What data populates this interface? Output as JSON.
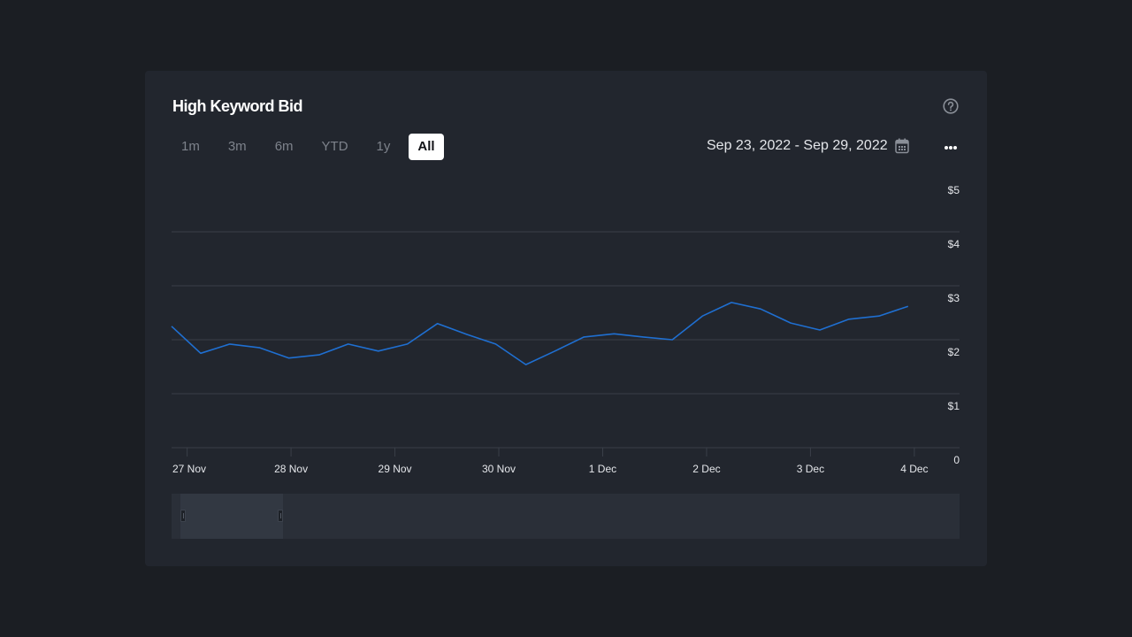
{
  "card": {
    "title": "High Keyword Bid",
    "help_icon": "question-circle-icon",
    "more_icon": "more-horizontal-icon",
    "calendar_icon": "calendar-icon"
  },
  "ranges": [
    {
      "label": "1m",
      "active": false
    },
    {
      "label": "3m",
      "active": false
    },
    {
      "label": "6m",
      "active": false
    },
    {
      "label": "YTD",
      "active": false
    },
    {
      "label": "1y",
      "active": false
    },
    {
      "label": "All",
      "active": true
    }
  ],
  "date_range": "Sep 23, 2022 - Sep 29, 2022",
  "colors": {
    "line": "#1f6fd1",
    "grid": "#3a3f48",
    "axis_text": "#e4e6ea"
  },
  "navigator": {
    "window_start_fraction": 0.0,
    "window_end_fraction": 0.13
  },
  "chart_data": {
    "type": "line",
    "title": "High Keyword Bid",
    "xlabel": "",
    "ylabel": "",
    "ylim": [
      0,
      5
    ],
    "yticks": [
      0,
      1,
      2,
      3,
      4,
      5
    ],
    "ytick_labels": [
      "0",
      "$1",
      "$2",
      "$3",
      "$4",
      "$5"
    ],
    "xlim": [
      -0.15,
      7.35
    ],
    "xticks": [
      0,
      1,
      2,
      3,
      4,
      5,
      6,
      7
    ],
    "xtick_labels": [
      "27 Nov",
      "28 Nov",
      "29 Nov",
      "30 Nov",
      "1 Dec",
      "2 Dec",
      "3 Dec",
      "4 Dec"
    ],
    "grid": true,
    "legend": "none",
    "series": [
      {
        "name": "High Keyword Bid",
        "x": [
          -0.15,
          0.13,
          0.41,
          0.7,
          0.98,
          1.27,
          1.55,
          1.84,
          2.12,
          2.41,
          2.69,
          2.97,
          3.26,
          3.54,
          3.82,
          4.11,
          4.39,
          4.67,
          4.96,
          5.24,
          5.52,
          5.81,
          6.09,
          6.37,
          6.66,
          6.94
        ],
        "values": [
          2.25,
          1.75,
          1.92,
          1.85,
          1.66,
          1.72,
          1.92,
          1.79,
          1.92,
          2.3,
          2.1,
          1.92,
          1.54,
          1.79,
          2.05,
          2.11,
          2.05,
          2.0,
          2.44,
          2.69,
          2.57,
          2.31,
          2.18,
          2.38,
          2.44,
          2.62
        ]
      }
    ]
  }
}
